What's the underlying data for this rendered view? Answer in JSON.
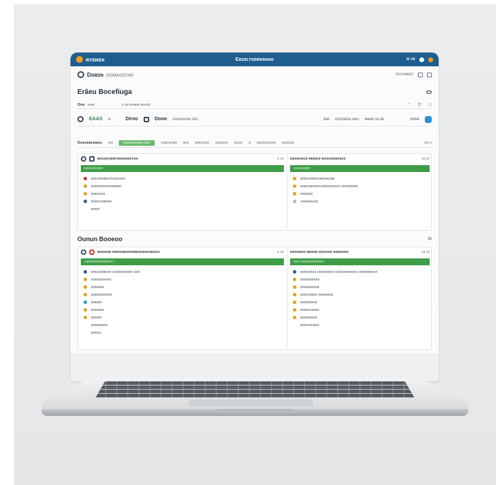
{
  "app": {
    "name": "ɴʏᴇɴᴅs",
    "window_title": "Eᴅᴄᴇʟᴛᴏᴅᴇɴᴀɴsᴏ",
    "titlebar_right": "ɪɪ ᴠᴇ"
  },
  "toolbar": {
    "brand": "Dᴏʙɪɴ",
    "subtitle": "ᴅᴏᴍᴀᴏᴏᴛʜᴏ",
    "right_label": "ᴅᴏᴄᴜᴍᴇɴᴛ"
  },
  "page": {
    "title": "Erâeu Bocefiuga"
  },
  "filters": {
    "label": "Ooe",
    "value": "ᴅᴀᴍ",
    "middle": "ᴏ ɪɴ ʙᴀɴᴏɴ ʙᴀᴏᴄᴇ",
    "right": [
      "⌃",
      "☰",
      "▢"
    ]
  },
  "stats": {
    "items": [
      {
        "value": "EAAS",
        "unit": "ᴏ"
      },
      {
        "value": "Dᴘᴏᴏ",
        "unit": ""
      },
      {
        "value": "Dᴏᴏɴ",
        "unit": "ᴅᴏᴍɪɴᴀᴏᴍ ɪɴᴅ"
      }
    ],
    "right": [
      "ɪɴʙ",
      "ᴏᴏɪɪᴅᴇᴅᴀ ʜɴᴜ",
      "ɴɴɴɴ ɪɴ ᴅᴇ",
      "ᴍɪɴɴ"
    ]
  },
  "tabs": {
    "label": "Oᴏᴜᴄᴇʀʟᴇᴍᴀs",
    "items": [
      "ʜɪɪ",
      "ᴏᴏᴏᴏᴏᴏᴏᴇɴ ᴄᴏᴄɪ",
      "ᴛᴀɴᴄᴀᴏᴍᴏ",
      "ɴᴏɪ",
      "ᴅᴇᴇᴏᴜᴏᴏ",
      "ᴅᴇᴏᴏᴏᴏ",
      "ᴅᴀᴏᴏ",
      "ᴏ",
      "ᴅᴇᴏᴏᴏᴜᴏᴏɴ",
      "ᴅᴏᴏᴄᴇɴ"
    ],
    "right": "ᴅᴏ ᴏ"
  },
  "section1": {
    "left_head": "ʙᴏᴄᴏᴄᴏᴋᴇᴛᴏᴇᴏᴀᴏɪᴀᴛᴀᴀ",
    "left_head_right": "ᴏ ɪᴏ",
    "left_green": "ᴅᴇᴏᴏᴀᴏᴏᴏᴏᴏ",
    "left_items": [
      {
        "text": "ᴅᴏᴄᴜᴏᴀɴᴏᴄᴛᴄᴏᴀᴄɪɪᴄᴀ",
        "color": "#c0392b"
      },
      {
        "text": "ᴅᴏᴏᴄᴇᴏᴏᴏᴄᴏᴏɪᴏᴏᴏ",
        "color": "#e0a21b"
      },
      {
        "text": "ᴅᴏᴏᴄᴏᴀᴀ",
        "color": "#e0a21b"
      },
      {
        "text": "ᴅᴏᴏᴄᴀᴀɴᴏᴏᴏ",
        "color": "#3b5b7a"
      },
      {
        "text": "ᴅᴏᴏᴏ",
        "color": ""
      }
    ],
    "right_head": "ᴅᴏᴏᴏᴀᴋᴄᴇ ᴇʀᴏɪᴄᴇ ʀᴄᴀᴀᴏᴏᴋᴀᴏᴄɪ",
    "right_head_right": "ᴅɪ ɪᴏ",
    "right_green": "ᴀᴀᴅᴀᴏᴏᴏᴏᴏ",
    "right_items": [
      {
        "text": "ᴅᴏᴏᴄᴏᴏɪᴏᴄᴏᴇᴏᴏᴀᴏᴏᴇ",
        "color": "#e0a21b"
      },
      {
        "text": "ᴅᴏᴏᴄᴏᴇᴏᴏᴀᴄᴄɪᴇᴏᴀᴏᴏᴄᴏᴀ ᴏᴏᴏᴏᴏᴏᴏᴏ",
        "color": "#e0a21b"
      },
      {
        "text": "ᴅᴏᴏᴄᴇᴏ",
        "color": "#e0a21b"
      },
      {
        "text": "ᴀᴀᴅᴀᴏᴀᴀᴏᴄ",
        "color": "#b0b6bb"
      }
    ]
  },
  "section2": {
    "title": "Ounun Booeoo",
    "title_right": "ɪᴏ",
    "left_head": "ʙᴀᴏᴏᴏᴋ ᴏɪɪɪᴀᴏᴇᴏᴀᴏɪʀᴇᴀᴏᴀᴏᴄᴇᴇᴀᴄᴀ",
    "left_head_right": "ᴏ ɪᴏ",
    "left_green": "ᴄᴏʀʀᴏᴏᴏᴏᴏᴏᴏᴇɪᴏᴏ ᴄ",
    "left_items": [
      {
        "text": "ᴅᴏᴄᴜᴄᴏʀᴀᴀᴏ ᴀᴀᴏᴇᴏᴀᴏᴏᴏᴏ ᴄᴏᴏ",
        "color": "#1f5d8f"
      },
      {
        "text": "ᴅᴏᴏᴄᴇᴏᴀᴀᴀᴏ",
        "color": "#e0a21b"
      },
      {
        "text": "ᴅᴏᴏᴏᴏᴏ",
        "color": "#e0a21b"
      },
      {
        "text": "ᴅᴏᴏᴄᴇᴏᴏᴏᴏᴏ",
        "color": "#e0a21b"
      },
      {
        "text": "ᴅᴏᴏᴏᴏ",
        "color": "#2f8fd6"
      },
      {
        "text": "ᴅᴏᴏᴏᴏᴏ",
        "color": "#e0a21b"
      },
      {
        "text": "ᴅᴏᴏᴏᴏ",
        "color": "#e0a21b"
      },
      {
        "text": "ᴅᴏᴏᴏᴇᴏᴏᴀ",
        "color": ""
      },
      {
        "text": "ᴅᴏᴏᴄᴀ",
        "color": ""
      }
    ],
    "right_head": "ᴅᴀᴏᴏᴇᴏᴏ ʙᴇᴏᴏᴇ ᴅᴏᴄᴀᴏᴏ ᴇᴀᴇᴏᴏᴏᴏ",
    "right_head_right": "ᴏɪ ɪᴏ",
    "right_green": "ᴏᴀᴀ ᴄᴏᴏᴏᴄᴏᴏᴏᴏᴏᴏᴏᴀ",
    "right_items": [
      {
        "text": "ᴅᴏᴏᴄᴏᴀᴀɪ ᴄᴏᴏᴏᴄᴏᴏᴏ ᴄᴏᴏᴄᴏᴀᴀᴏᴏᴏᴀ ᴄᴏᴏᴄᴏᴇᴏᴀᴀᴀ",
        "color": "#1f5d8f"
      },
      {
        "text": "ᴅᴏᴏᴏᴏᴏᴏᴏᴏ",
        "color": "#e0a21b"
      },
      {
        "text": "ᴅᴏᴏᴏᴏᴏᴏᴏᴇ",
        "color": "#e0a21b"
      },
      {
        "text": "ᴅᴏᴏᴄᴏᴏᴏᴏ ᴏᴏᴏᴏᴏᴏᴏ",
        "color": "#e0a21b"
      },
      {
        "text": "ᴅᴏᴏᴏᴏᴏᴏᴏ",
        "color": "#e0a21b"
      },
      {
        "text": "ᴅᴏᴏᴏᴄᴏᴏᴏᴏ",
        "color": "#e0a21b"
      },
      {
        "text": "ᴅᴏᴏᴏᴏᴏᴏᴏ",
        "color": "#e0a21b"
      },
      {
        "text": "ᴅᴏᴏᴄᴏᴄᴏᴏᴏ",
        "color": ""
      }
    ]
  }
}
